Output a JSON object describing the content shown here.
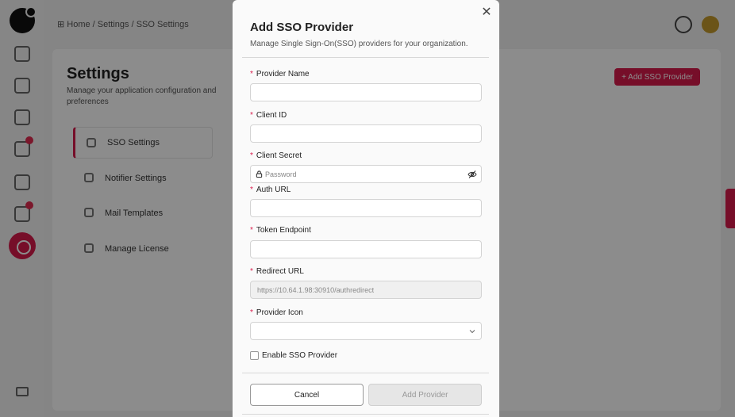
{
  "background": {
    "breadcrumb": "⊞ Home / Settings / SSO Settings",
    "settings_title": "Settings",
    "settings_subtitle": "Manage your application configuration and preferences",
    "menu": [
      {
        "label": "SSO Settings",
        "icon": "lock-icon"
      },
      {
        "label": "Notifier Settings",
        "icon": "bell-icon"
      },
      {
        "label": "Mail Templates",
        "icon": "mail-icon"
      },
      {
        "label": "Manage License",
        "icon": "key-icon"
      }
    ],
    "add_button": "+ Add SSO Provider",
    "accent_color": "#d81b4b"
  },
  "modal": {
    "title": "Add SSO Provider",
    "description": "Manage Single Sign-On(SSO) providers for your organization.",
    "required_marker": "*",
    "fields": {
      "provider_name": {
        "label": "Provider Name",
        "value": ""
      },
      "client_id": {
        "label": "Client ID",
        "value": ""
      },
      "client_secret": {
        "label": "Client Secret",
        "placeholder": "Password"
      },
      "auth_url": {
        "label": "Auth URL",
        "value": ""
      },
      "token_endpoint": {
        "label": "Token Endpoint",
        "value": ""
      },
      "redirect_url": {
        "label": "Redirect URL",
        "value": "https://10.64.1.98:30910/authredirect"
      },
      "provider_icon": {
        "label": "Provider Icon",
        "value": ""
      }
    },
    "enable_label": "Enable SSO Provider",
    "enable_checked": false,
    "cancel_label": "Cancel",
    "add_label": "Add Provider"
  }
}
